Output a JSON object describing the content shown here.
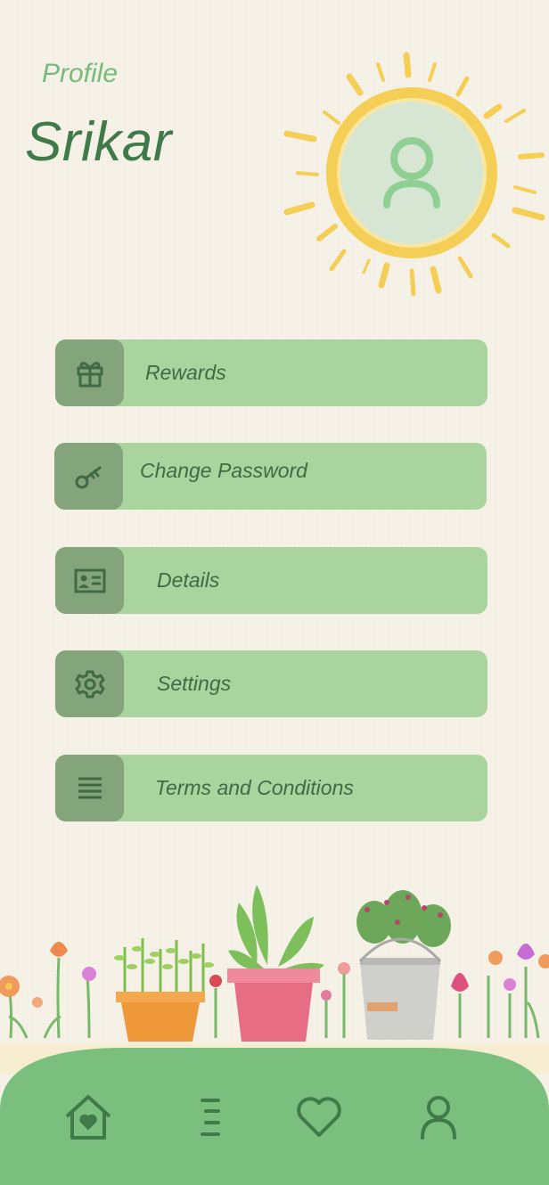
{
  "header": {
    "subtitle": "Profile",
    "username": "Srikar"
  },
  "avatar": {
    "icon": "user-icon"
  },
  "menu": [
    {
      "label": "Rewards",
      "icon": "gift-icon"
    },
    {
      "label": "Change Password",
      "icon": "key-icon"
    },
    {
      "label": "Details",
      "icon": "id-card-icon"
    },
    {
      "label": "Settings",
      "icon": "gear-icon"
    },
    {
      "label": "Terms and Conditions",
      "icon": "lines-icon"
    }
  ],
  "bottom_nav": [
    {
      "icon": "home-heart-icon"
    },
    {
      "icon": "list-icon"
    },
    {
      "icon": "heart-icon"
    },
    {
      "icon": "profile-icon"
    }
  ],
  "colors": {
    "background": "#f7f2e8",
    "accent_green": "#76bb7b",
    "dark_green": "#3f7a48",
    "menu_bg": "#a9d49e",
    "menu_icon_bg": "#84a57c",
    "nav_bg": "#7bbf7f",
    "sun": "#f4ce55"
  }
}
